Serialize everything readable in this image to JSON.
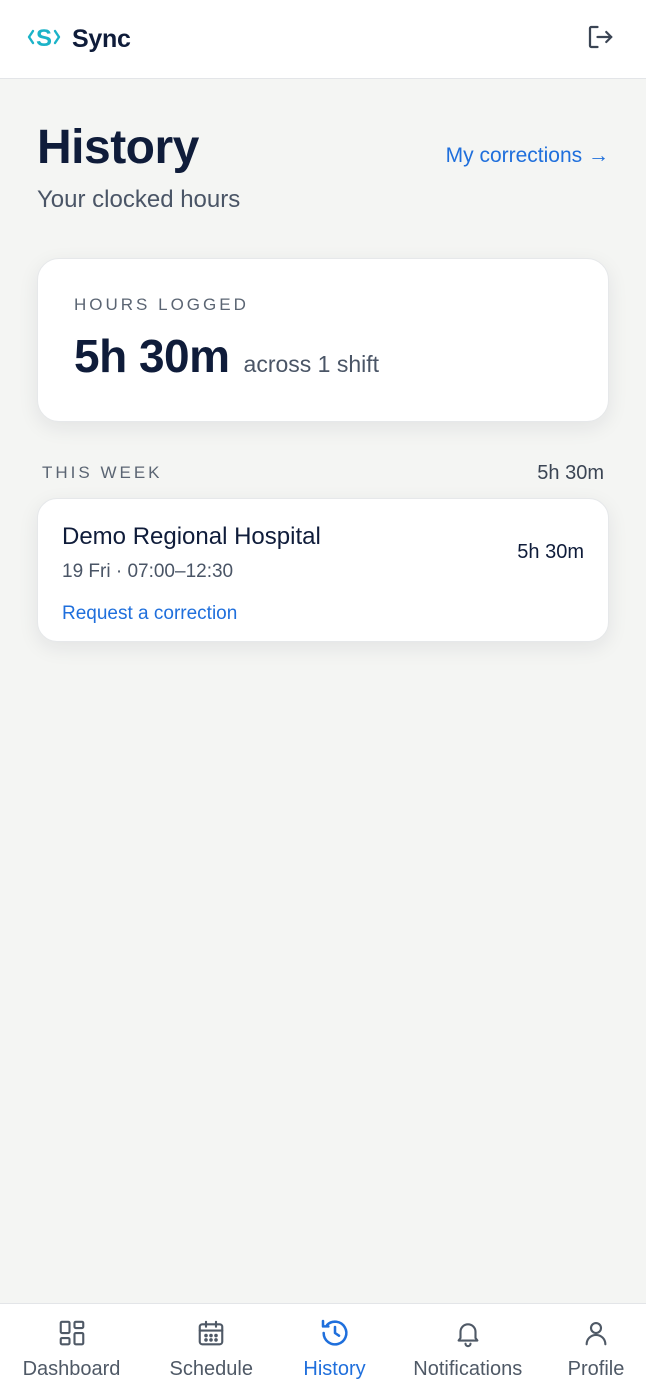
{
  "app": {
    "name": "Sync",
    "accent_color": "#1f6fdc",
    "logo_color": "#1bb3c8",
    "logout_icon": "logout-icon"
  },
  "header": {
    "title": "History",
    "subtitle": "Your clocked hours",
    "corrections_link": "My corrections →"
  },
  "summary": {
    "label": "HOURS LOGGED",
    "value": "5h 30m",
    "sub": "across 1 shift"
  },
  "week": {
    "label": "THIS WEEK",
    "total": "5h 30m",
    "shifts": [
      {
        "place": "Demo Regional Hospital",
        "when": "19 Fri · 07:00–12:30",
        "duration": "5h 30m",
        "action": "Request a correction"
      }
    ]
  },
  "nav": {
    "items": [
      {
        "label": "Dashboard",
        "icon": "dashboard-icon",
        "active": false
      },
      {
        "label": "Schedule",
        "icon": "calendar-icon",
        "active": false
      },
      {
        "label": "History",
        "icon": "history-icon",
        "active": true
      },
      {
        "label": "Notifications",
        "icon": "bell-icon",
        "active": false
      },
      {
        "label": "Profile",
        "icon": "user-icon",
        "active": false
      }
    ]
  }
}
